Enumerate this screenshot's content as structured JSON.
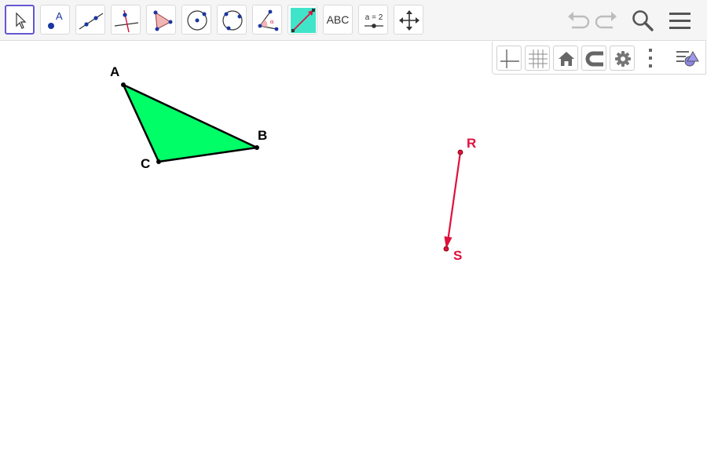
{
  "toolbar": {
    "tools": [
      {
        "name": "move-tool",
        "icon": "arrow-pointer-icon",
        "active": true
      },
      {
        "name": "point-tool",
        "icon": "point-icon",
        "label": "A"
      },
      {
        "name": "line-tool",
        "icon": "line-through-two-points-icon"
      },
      {
        "name": "perpendicular-line-tool",
        "icon": "perpendicular-line-icon"
      },
      {
        "name": "polygon-tool",
        "icon": "polygon-icon"
      },
      {
        "name": "circle-center-point-tool",
        "icon": "circle-icon"
      },
      {
        "name": "circle-three-points-tool",
        "icon": "circle-three-points-icon"
      },
      {
        "name": "angle-tool",
        "icon": "angle-icon",
        "label": "α"
      },
      {
        "name": "translate-by-vector-tool",
        "icon": "vector-icon"
      },
      {
        "name": "text-tool",
        "icon": "text-icon",
        "label": "ABC"
      },
      {
        "name": "slider-tool",
        "icon": "slider-icon",
        "label": "a = 2"
      },
      {
        "name": "move-graphics-view-tool",
        "icon": "move-arrows-icon"
      }
    ],
    "right": [
      "undo-icon",
      "redo-icon",
      "search-icon",
      "menu-icon"
    ]
  },
  "style_bar": {
    "buttons": [
      "axes-icon",
      "grid-icon",
      "home-icon",
      "magnet-icon",
      "gear-icon",
      "more-vert-icon",
      "toggle-style-bar-icon"
    ]
  },
  "construction": {
    "triangle": {
      "points": [
        "A",
        "B",
        "C"
      ],
      "fill": "#00ff66",
      "stroke": "#000000"
    },
    "vector": {
      "from": "R",
      "to": "S",
      "color": "#e0103c"
    },
    "labels": {
      "A": "A",
      "B": "B",
      "C": "C",
      "R": "R",
      "S": "S"
    }
  }
}
